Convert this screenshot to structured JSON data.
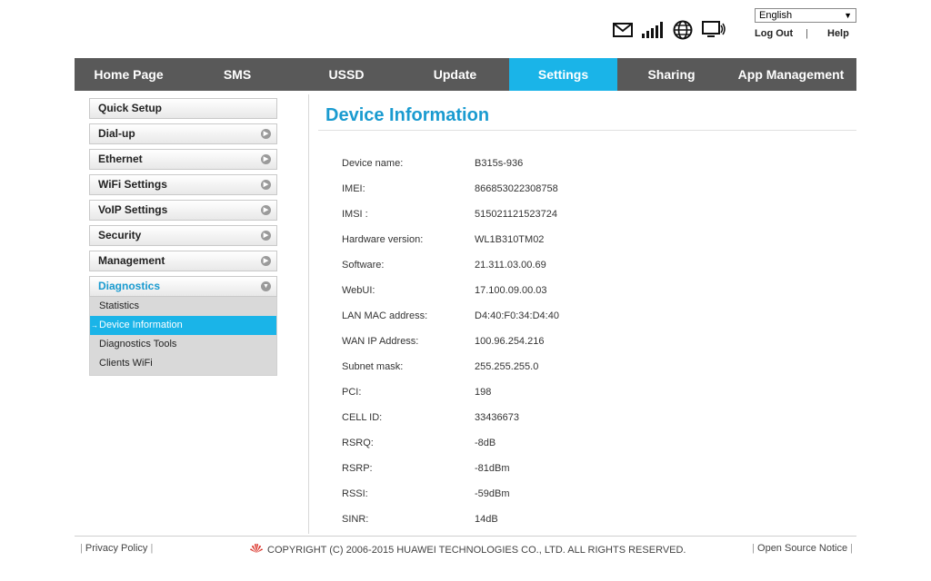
{
  "header": {
    "language": "English",
    "logout_label": "Log Out",
    "separator": "|",
    "help_label": "Help",
    "icons": [
      "mail-icon",
      "signal-icon",
      "globe-icon",
      "monitor-icon"
    ]
  },
  "nav": {
    "items": [
      "Home Page",
      "SMS",
      "USSD",
      "Update",
      "Settings",
      "Sharing",
      "App Management"
    ],
    "active": "Settings",
    "active_color": "#1ab4e8",
    "bar_color": "#595959"
  },
  "sidebar": {
    "items": [
      "Quick Setup",
      "Dial-up",
      "Ethernet",
      "WiFi Settings",
      "VoIP Settings",
      "Security",
      "Management",
      "Diagnostics"
    ],
    "open_item": "Diagnostics",
    "submenu": [
      "Statistics",
      "Device Information",
      "Diagnostics Tools",
      "Clients WiFi"
    ],
    "active_sub": "Device Information"
  },
  "main": {
    "title": "Device Information",
    "rows": [
      {
        "label": "Device name:",
        "value": "B315s-936"
      },
      {
        "label": "IMEI:",
        "value": "866853022308758"
      },
      {
        "label": "IMSI :",
        "value": "515021121523724"
      },
      {
        "label": "Hardware version:",
        "value": "WL1B310TM02"
      },
      {
        "label": "Software:",
        "value": "21.311.03.00.69"
      },
      {
        "label": "WebUI:",
        "value": "17.100.09.00.03"
      },
      {
        "label": "LAN MAC address:",
        "value": "D4:40:F0:34:D4:40"
      },
      {
        "label": "WAN IP Address:",
        "value": "100.96.254.216"
      },
      {
        "label": "Subnet mask:",
        "value": "255.255.255.0"
      },
      {
        "label": "PCI:",
        "value": "198"
      },
      {
        "label": "CELL ID:",
        "value": "33436673"
      },
      {
        "label": "RSRQ:",
        "value": "-8dB"
      },
      {
        "label": "RSRP:",
        "value": "-81dBm"
      },
      {
        "label": "RSSI:",
        "value": "-59dBm"
      },
      {
        "label": "SINR:",
        "value": "14dB"
      }
    ]
  },
  "footer": {
    "privacy_label": "Privacy Policy",
    "copyright": "COPYRIGHT (C) 2006-2015 HUAWEI TECHNOLOGIES CO., LTD. ALL RIGHTS RESERVED.",
    "oss_label": "Open Source Notice"
  }
}
